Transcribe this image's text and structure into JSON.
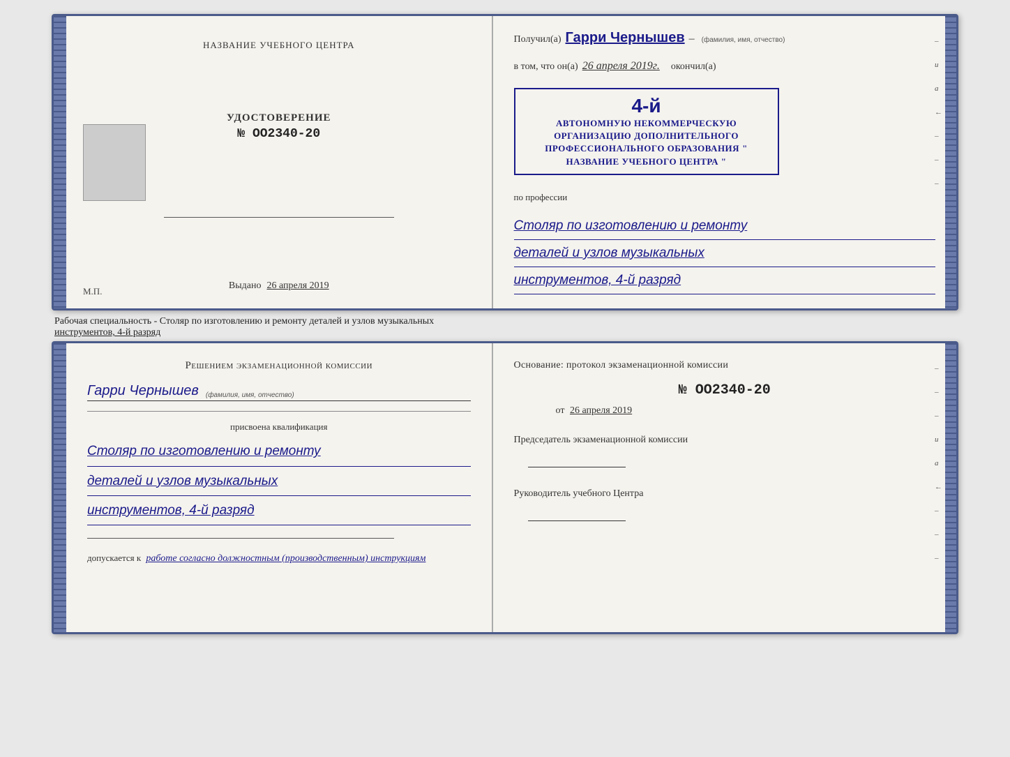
{
  "top_booklet": {
    "left": {
      "org_title": "НАЗВАНИЕ УЧЕБНОГО ЦЕНТРА",
      "udostoverenie_label": "УДОСТОВЕРЕНИЕ",
      "number": "№ OO2340-20",
      "vydano_label": "Выдано",
      "vydano_date": "26 апреля 2019",
      "mp_label": "М.П."
    },
    "right": {
      "poluchil_label": "Получил(а)",
      "recipient_name": "Гарри Чернышев",
      "name_hint": "(фамилия, имя, отчество)",
      "dash": "–",
      "vtom_label": "в том, что он(а)",
      "date_value": "26 апреля 2019г.",
      "okonchil_label": "окончил(а)",
      "stamp_number": "4-й",
      "stamp_line1": "АВТОНОМНУЮ НЕКОММЕРЧЕСКУЮ ОРГАНИЗАЦИЮ",
      "stamp_line2": "ДОПОЛНИТЕЛЬНОГО ПРОФЕССИОНАЛЬНОГО ОБРАЗОВАНИЯ",
      "stamp_line3": "\" НАЗВАНИЕ УЧЕБНОГО ЦЕНТРА \"",
      "po_professii_label": "по профессии",
      "profession_line1": "Столяр по изготовлению и ремонту",
      "profession_line2": "деталей и узлов музыкальных",
      "profession_line3": "инструментов, 4-й разряд"
    }
  },
  "caption": {
    "text_before": "Рабочая специальность - Столяр по изготовлению и ремонту деталей и узлов музыкальных",
    "text_underline": "инструментов, 4-й разряд"
  },
  "bottom_booklet": {
    "left": {
      "decision_title": "Решением  экзаменационной  комиссии",
      "name": "Гарри Чернышев",
      "name_hint": "(фамилия, имя, отчество)",
      "prisvoyena_label": "присвоена квалификация",
      "qualification_line1": "Столяр по изготовлению и ремонту",
      "qualification_line2": "деталей и узлов музыкальных",
      "qualification_line3": "инструментов, 4-й разряд",
      "dopuskaetsya_label": "допускается к",
      "dopuskaetsya_value": "работе согласно должностным (производственным) инструкциям"
    },
    "right": {
      "osnovaniye_label": "Основание: протокол экзаменационной  комиссии",
      "number": "№  OO2340-20",
      "ot_label": "от",
      "ot_date": "26 апреля 2019",
      "predsedatel_label": "Председатель экзаменационной комиссии",
      "rukovoditel_label": "Руководитель учебного Центра"
    }
  }
}
